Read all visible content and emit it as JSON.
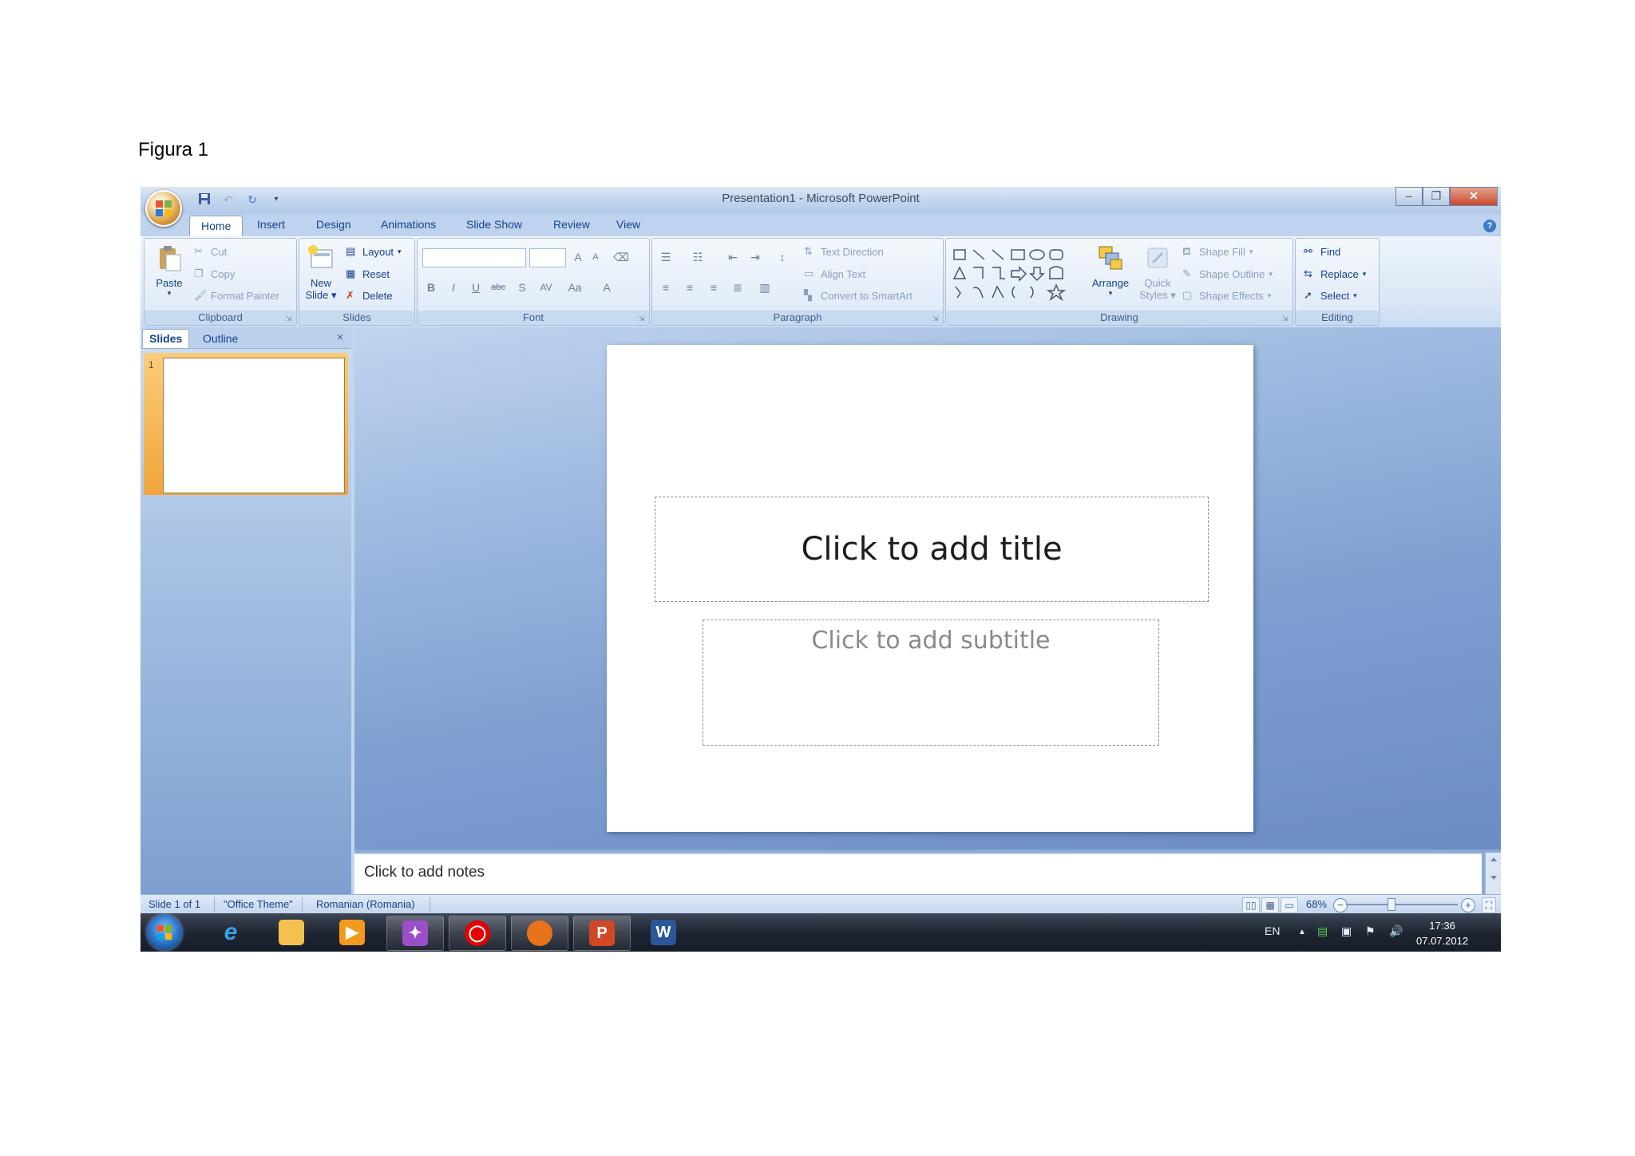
{
  "caption": "Figura 1",
  "window": {
    "title": "Presentation1 - Microsoft PowerPoint"
  },
  "tabs": [
    "Home",
    "Insert",
    "Design",
    "Animations",
    "Slide Show",
    "Review",
    "View"
  ],
  "ribbon": {
    "clipboard": {
      "label": "Clipboard",
      "paste": "Paste",
      "cut": "Cut",
      "copy": "Copy",
      "format_painter": "Format Painter"
    },
    "slides": {
      "label": "Slides",
      "new_slide_1": "New",
      "new_slide_2": "Slide",
      "layout": "Layout",
      "reset": "Reset",
      "delete": "Delete"
    },
    "font": {
      "label": "Font",
      "bold": "B",
      "italic": "I",
      "underline": "U",
      "strike": "abc",
      "shadow": "S",
      "spacing": "AV",
      "case": "Aa",
      "grow": "A",
      "shrink": "A",
      "clear": "A"
    },
    "paragraph": {
      "label": "Paragraph",
      "text_direction": "Text Direction",
      "align_text": "Align Text",
      "convert_smartart": "Convert to SmartArt"
    },
    "drawing": {
      "label": "Drawing",
      "arrange": "Arrange",
      "quick_styles_1": "Quick",
      "quick_styles_2": "Styles",
      "shape_fill": "Shape Fill",
      "shape_outline": "Shape Outline",
      "shape_effects": "Shape Effects"
    },
    "editing": {
      "label": "Editing",
      "find": "Find",
      "replace": "Replace",
      "select": "Select"
    }
  },
  "left_pane": {
    "tabs": [
      "Slides",
      "Outline"
    ],
    "close": "×",
    "slide_number": "1"
  },
  "slide": {
    "title_placeholder": "Click to add title",
    "subtitle_placeholder": "Click to add subtitle"
  },
  "notes": {
    "placeholder": "Click to add notes"
  },
  "status": {
    "slide_count": "Slide 1 of 1",
    "theme": "\"Office Theme\"",
    "language": "Romanian (Romania)",
    "zoom": "68%"
  },
  "taskbar": {
    "language": "EN",
    "time": "17:36",
    "date": "07.07.2012"
  },
  "colors": {
    "ribbon_text": "#15428b",
    "active_thumb": "#f1a43a",
    "taskbar": "#1f2633"
  }
}
